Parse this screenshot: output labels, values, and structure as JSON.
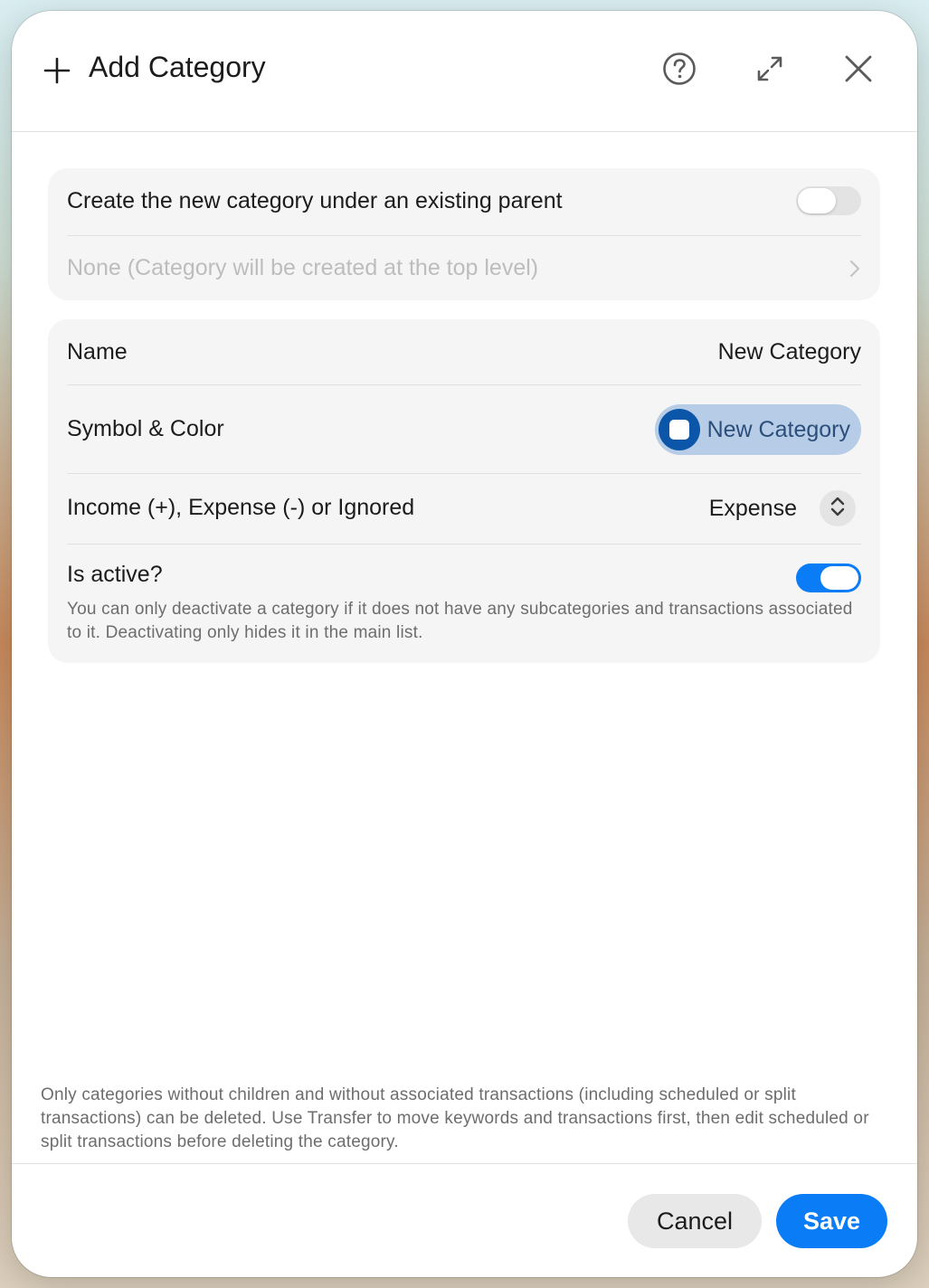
{
  "dialog": {
    "title": "Add Category",
    "icons": {
      "add": "plus-icon",
      "help": "question-circle-icon",
      "expand": "expand-arrows-icon",
      "close": "close-icon"
    }
  },
  "parent_section": {
    "toggle_label": "Create the new category under an existing parent",
    "toggle_on": false,
    "parent_value": "None (Category will be created at the top level)"
  },
  "details": {
    "name_label": "Name",
    "name_value": "New Category",
    "symbol_label": "Symbol & Color",
    "symbol_chip_label": "New Category",
    "symbol_color": "#0b56a8",
    "type_label": "Income (+), Expense (-) or Ignored",
    "type_value": "Expense",
    "active_label": "Is active?",
    "active_on": true,
    "active_hint": "You can only deactivate a category if it does not have any subcategories and transactions associated to it. Deactivating only hides it in the main list."
  },
  "footer": {
    "note": "Only categories without children and without associated transactions (including scheduled or split transactions) can be deleted. Use Transfer to move keywords and transactions first, then edit scheduled or split transactions before deleting the category.",
    "cancel_label": "Cancel",
    "save_label": "Save"
  },
  "colors": {
    "accent": "#0a7cf6"
  }
}
